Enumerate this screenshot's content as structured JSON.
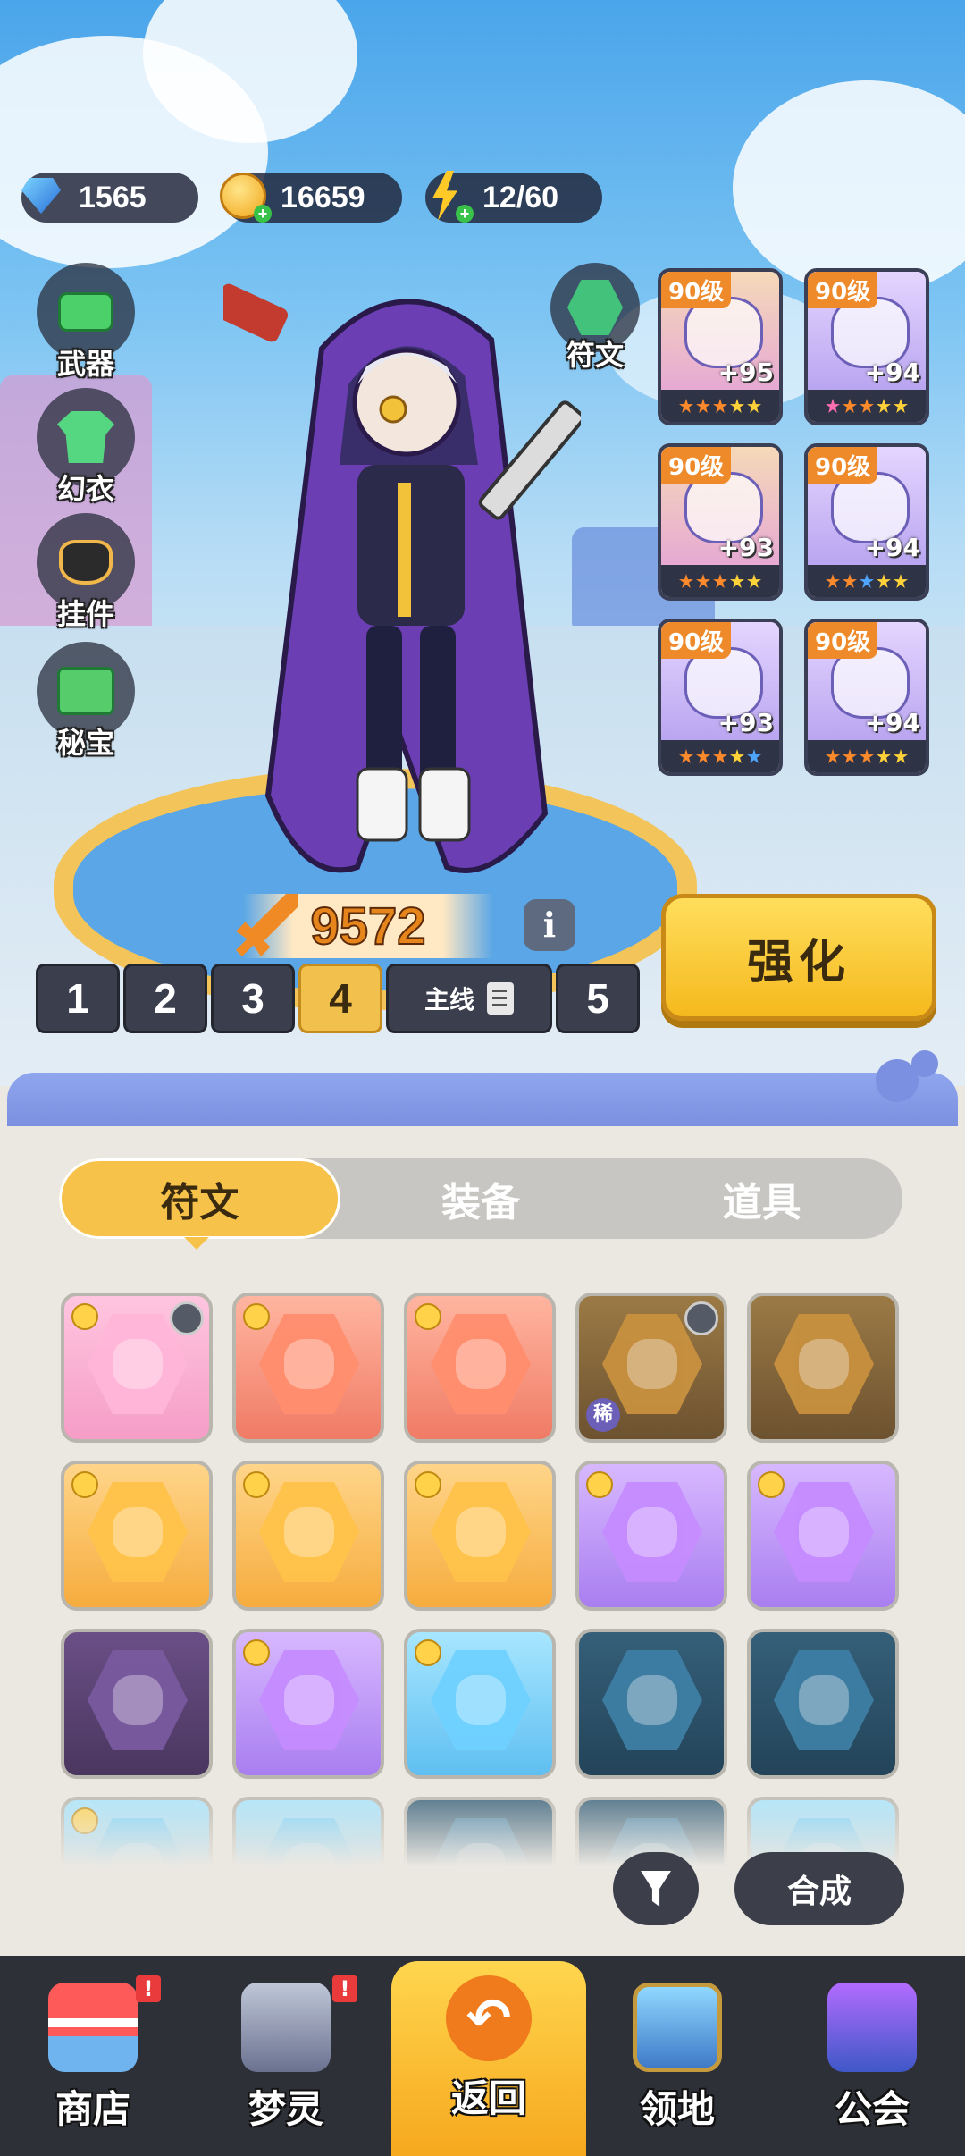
{
  "resources": {
    "gems": "1565",
    "coins": "16659",
    "energy": "12/60"
  },
  "side_menu": [
    {
      "label": "武器",
      "icon": "weapon-icon"
    },
    {
      "label": "幻衣",
      "icon": "outfit-icon"
    },
    {
      "label": "挂件",
      "icon": "pendant-icon"
    },
    {
      "label": "秘宝",
      "icon": "treasure-icon"
    }
  ],
  "rune_button": {
    "label": "符文",
    "icon": "rune-icon"
  },
  "equipment": [
    {
      "level": "90级",
      "plus": "+95",
      "icon": "helmet-icon"
    },
    {
      "level": "90级",
      "plus": "+94",
      "icon": "armor-icon"
    },
    {
      "level": "90级",
      "plus": "+93",
      "icon": "bracer-icon"
    },
    {
      "level": "90级",
      "plus": "+94",
      "icon": "pants-icon"
    },
    {
      "level": "90级",
      "plus": "+93",
      "icon": "shoes-icon"
    },
    {
      "level": "90级",
      "plus": "+94",
      "icon": "orb-icon"
    }
  ],
  "power": {
    "value": "9572"
  },
  "info_label": "i",
  "loadouts": {
    "slots": [
      "1",
      "2",
      "3",
      "4"
    ],
    "selected": "4",
    "main_label": "主线",
    "last": "5"
  },
  "upgrade_label": "强化",
  "tabs": [
    "符文",
    "装备",
    "道具"
  ],
  "selected_tab": "符文",
  "rare_label": "稀",
  "actions": {
    "compose": "合成"
  },
  "nav": [
    {
      "label": "商店",
      "icon": "shop-icon",
      "badge": "!"
    },
    {
      "label": "梦灵",
      "icon": "dream-spirit-icon",
      "badge": "!"
    },
    {
      "label": "返回",
      "icon": "back-icon"
    },
    {
      "label": "领地",
      "icon": "territory-icon"
    },
    {
      "label": "公会",
      "icon": "guild-icon"
    }
  ],
  "colors": {
    "accent": "#f6c24a",
    "dark_ui": "#3c3f4a",
    "badge": "#e93b3b"
  }
}
